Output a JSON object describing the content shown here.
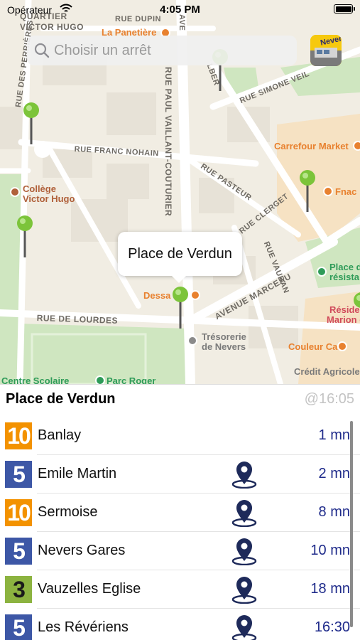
{
  "status_bar": {
    "carrier": "Opérateur",
    "time": "4:05 PM"
  },
  "search": {
    "placeholder": "Choisir un arrêt",
    "logo_text": "Nevers"
  },
  "map": {
    "streets": [
      "RUE DUPIN",
      "RUE SIMONE VEIL",
      "RUE FRANC NOHAIN",
      "RUE PASTEUR",
      "RUE CLERGET",
      "RUE VAUBAN",
      "AVENUE MARCEAU",
      "RUE DE LOURDES",
      "RUE DES PERRIÈRES",
      "RUE PAUL VAILLANT-COUTURIER",
      "QUARTIER",
      "VICTOR HUGO",
      "AVE",
      "LBER"
    ],
    "pois": [
      {
        "name": "La Panetière",
        "color": "#e8812f"
      },
      {
        "name": "Carrefour Market",
        "color": "#e8812f"
      },
      {
        "name": "Fnac",
        "color": "#e8812f"
      },
      {
        "name": "Collège",
        "color": "#b0603a"
      },
      {
        "name": "Victor Hugo",
        "color": "#b0603a"
      },
      {
        "name": "Dessa",
        "color": "#e8812f"
      },
      {
        "name": "Trésorerie",
        "color": "#7a7a7a"
      },
      {
        "name": "de Nevers",
        "color": "#7a7a7a"
      },
      {
        "name": "Couleur Café",
        "color": "#e8812f"
      },
      {
        "name": "Crédit Agricole",
        "color": "#7a7a7a"
      },
      {
        "name": "Place de",
        "color": "#2e9b58"
      },
      {
        "name": "résista",
        "color": "#2e9b58"
      },
      {
        "name": "Réside",
        "color": "#d04a5a"
      },
      {
        "name": "Marion de G",
        "color": "#d04a5a"
      },
      {
        "name": "Centre Scolaire",
        "color": "#2e9b58"
      },
      {
        "name": "Parc Roger",
        "color": "#2e9b58"
      }
    ],
    "callout": "Place de Verdun"
  },
  "panel": {
    "stop_name": "Place de Verdun",
    "updated": "@16:05",
    "departures": [
      {
        "line": "10",
        "color": "#f39200",
        "text_color": "#ffffff",
        "destination": "Banlay",
        "time": "1 mn",
        "locate": false
      },
      {
        "line": "5",
        "color": "#3d57a6",
        "text_color": "#ffffff",
        "destination": "Emile Martin",
        "time": "2 mn",
        "locate": true
      },
      {
        "line": "10",
        "color": "#f39200",
        "text_color": "#ffffff",
        "destination": "Sermoise",
        "time": "8 mn",
        "locate": true
      },
      {
        "line": "5",
        "color": "#3d57a6",
        "text_color": "#ffffff",
        "destination": "Nevers Gares",
        "time": "10 mn",
        "locate": true
      },
      {
        "line": "3",
        "color": "#8cb340",
        "text_color": "#1a1a1a",
        "destination": "Vauzelles Eglise",
        "time": "18 mn",
        "locate": true
      },
      {
        "line": "5",
        "color": "#3d57a6",
        "text_color": "#ffffff",
        "destination": "Les Révériens",
        "time": "16:30",
        "locate": true
      }
    ]
  }
}
